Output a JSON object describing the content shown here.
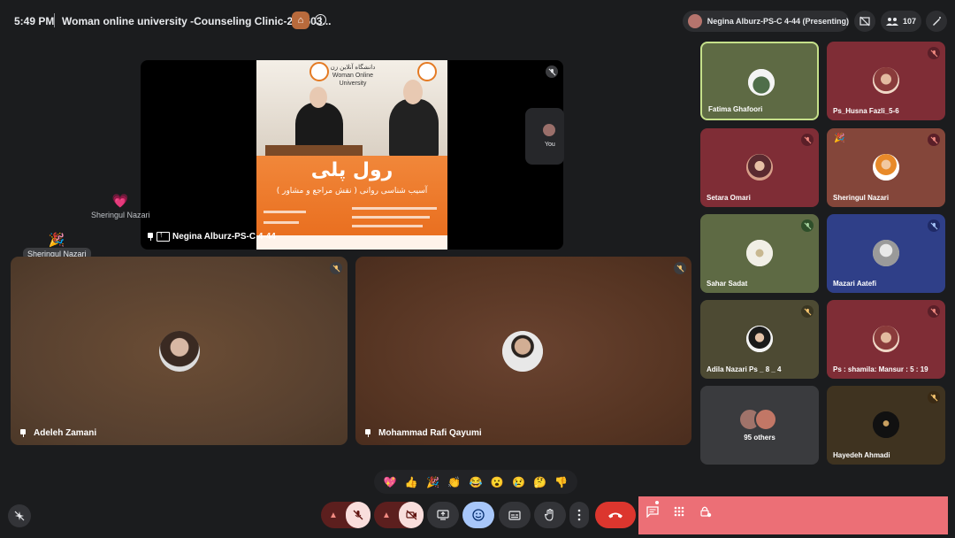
{
  "header": {
    "time": "5:49 PM",
    "meeting_title": "Woman online university -Counseling Clinic-202603...",
    "presenter_pill": "Negina Alburz-PS-C 4-44 (Presenting)",
    "participant_count": "107",
    "icons": [
      "room-badge-icon",
      "info-icon",
      "hide-tiles-icon",
      "people-icon",
      "pen-icon"
    ]
  },
  "presentation": {
    "presenter_label": "Negina Alburz-PS-C 4-44",
    "self_label": "You",
    "poster": {
      "title": "رول پلی",
      "subtitle": "( نقش مراجع و مشاور ) آسیب شناسی روانی"
    }
  },
  "reactions": [
    {
      "emoji": "💗",
      "name": "Sheringul Nazari"
    },
    {
      "emoji": "🎉",
      "name": "Sheringul Nazari"
    }
  ],
  "main_tiles": [
    {
      "name": "Adeleh Zamani",
      "muted": true
    },
    {
      "name": "Mohammad Rafi Qayumi",
      "muted": true
    }
  ],
  "side_tiles": [
    {
      "name": "Fatima Ghafoori",
      "active_speaker": true
    },
    {
      "name": "Ps_Husna Fazli_5-6",
      "muted": true
    },
    {
      "name": "Setara Omari",
      "muted": true
    },
    {
      "name": "Sheringul Nazari",
      "muted": true
    },
    {
      "name": "Sahar Sadat",
      "muted": true
    },
    {
      "name": "Mazari Aatefi",
      "muted": true
    },
    {
      "name": "Adila Nazari Ps _ 8 _ 4",
      "muted": true
    },
    {
      "name": "Ps : shamila: Mansur : 5 : 19",
      "muted": true
    },
    {
      "name": "95 others",
      "muted": false
    },
    {
      "name": "Hayedeh Ahmadi",
      "muted": true
    }
  ],
  "emoji_reactions": [
    "💖",
    "👍",
    "🎉",
    "👏",
    "😂",
    "😮",
    "😢",
    "🤔",
    "👎"
  ],
  "controls": {
    "left": "noise-cancel-icon",
    "center": [
      "mic-options",
      "mic-off",
      "camera-options",
      "camera-off",
      "present-screen",
      "emoji-reaction",
      "captions",
      "raise-hand",
      "more-options",
      "leave-call"
    ],
    "right": [
      "chat",
      "activities",
      "host-controls"
    ]
  },
  "colors": {
    "background": "#1b1c1e",
    "accent_blue": "#a8c7fa",
    "hangup_red": "#dc362e",
    "panel_pink": "#ec6f76",
    "active_border": "#c5e08a"
  }
}
